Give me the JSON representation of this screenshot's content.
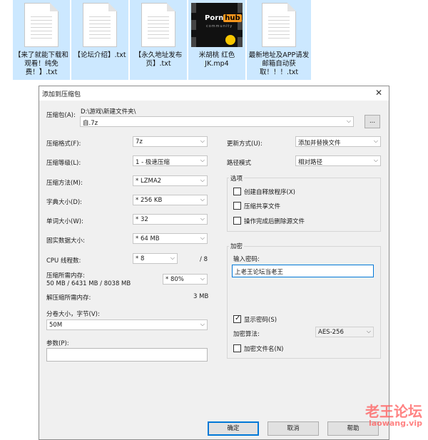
{
  "desktop": {
    "files": [
      {
        "name": "【来了就能下载和观看！纯免费！】.txt",
        "type": "txt"
      },
      {
        "name": "【论坛介绍】.txt",
        "type": "txt"
      },
      {
        "name": "【永久地址发布页】.txt",
        "type": "txt"
      },
      {
        "name": "米胡桃 红色JK.mp4",
        "type": "video",
        "thumb_logo_a": "Porn",
        "thumb_logo_b": "hub",
        "thumb_sub": "community"
      },
      {
        "name": "最新地址及APP请发邮箱自动获取！！！.txt",
        "type": "txt"
      }
    ]
  },
  "dialog": {
    "title": "添加到压缩包",
    "close_icon": "close-icon",
    "archive_label": "压缩包(A):",
    "archive_path": "D:\\游戏\\新建文件夹\\",
    "archive_name": "自.7z",
    "browse_label": "...",
    "left": {
      "format_label": "压缩格式(F):",
      "format_value": "7z",
      "level_label": "压缩等级(L):",
      "level_value": "1 - 极速压缩",
      "method_label": "压缩方法(M):",
      "method_value": "* LZMA2",
      "dict_label": "字典大小(D):",
      "dict_value": "* 256 KB",
      "word_label": "单词大小(W):",
      "word_value": "* 32",
      "solid_label": "固实数据大小:",
      "solid_value": "* 64 MB",
      "cpu_label": "CPU 线程数:",
      "cpu_value": "* 8",
      "cpu_total": "/ 8",
      "mem_label": "压缩所需内存:",
      "mem_detail": "50 MB / 6431 MB / 8038 MB",
      "mem_value": "* 80%",
      "decomp_label": "解压缩所需内存:",
      "decomp_value": "3 MB",
      "split_label": "分卷大小，字节(V):",
      "split_value": "50M",
      "params_label": "参数(P):",
      "params_value": ""
    },
    "right": {
      "update_label": "更新方式(U):",
      "update_value": "添加并替换文件",
      "path_label": "路径模式",
      "path_value": "相对路径",
      "options_title": "选项",
      "opt_sfx": "创建自释放程序(X)",
      "opt_shared": "压缩共享文件",
      "opt_delete": "操作完成后删除源文件",
      "encrypt_title": "加密",
      "password_label": "输入密码:",
      "password_value": "上老王论坛当老王",
      "show_password": "显示密码(S)",
      "show_password_checked": true,
      "enc_method_label": "加密算法:",
      "enc_method_value": "AES-256",
      "encrypt_names": "加密文件名(N)"
    },
    "buttons": {
      "ok": "确定",
      "cancel": "取消",
      "help": "帮助"
    }
  },
  "watermark": {
    "cn": "老王论坛",
    "url": "laowang.vip"
  }
}
